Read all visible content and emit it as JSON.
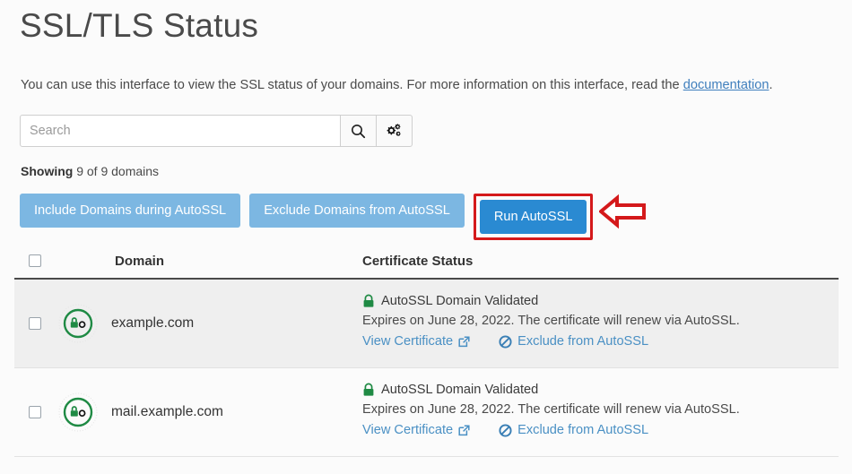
{
  "header": {
    "title": "SSL/TLS Status",
    "intro_before": "You can use this interface to view the SSL status of your domains. For more information on this interface, read the ",
    "intro_link": "documentation",
    "intro_after": "."
  },
  "search": {
    "placeholder": "Search",
    "value": "",
    "search_icon": "search-icon",
    "settings_icon": "cogs-icon"
  },
  "showing": {
    "label": "Showing",
    "text": " 9 of 9 domains"
  },
  "actions": {
    "include_label": "Include Domains during AutoSSL",
    "exclude_label": "Exclude Domains from AutoSSL",
    "run_label": "Run AutoSSL",
    "muted_color": "#7cb7e2",
    "primary_color": "#2a8ad2",
    "highlight_color": "#d4191b",
    "annotation_icon": "left-arrow-annotation"
  },
  "table": {
    "columns": {
      "select_all": "select-all-checkbox",
      "domain": "Domain",
      "status": "Certificate Status"
    },
    "rows": [
      {
        "domain": "example.com",
        "icon": "ssl-validated-icon",
        "icon_color": "#1f8a44",
        "status_title": "AutoSSL Domain Validated",
        "status_detail": "Expires on June 28, 2022. The certificate will renew via AutoSSL.",
        "view_link": "View Certificate",
        "exclude_link": "Exclude from AutoSSL"
      },
      {
        "domain": "mail.example.com",
        "icon": "ssl-validated-icon",
        "icon_color": "#1f8a44",
        "status_title": "AutoSSL Domain Validated",
        "status_detail": "Expires on June 28, 2022. The certificate will renew via AutoSSL.",
        "view_link": "View Certificate",
        "exclude_link": "Exclude from AutoSSL"
      }
    ]
  }
}
